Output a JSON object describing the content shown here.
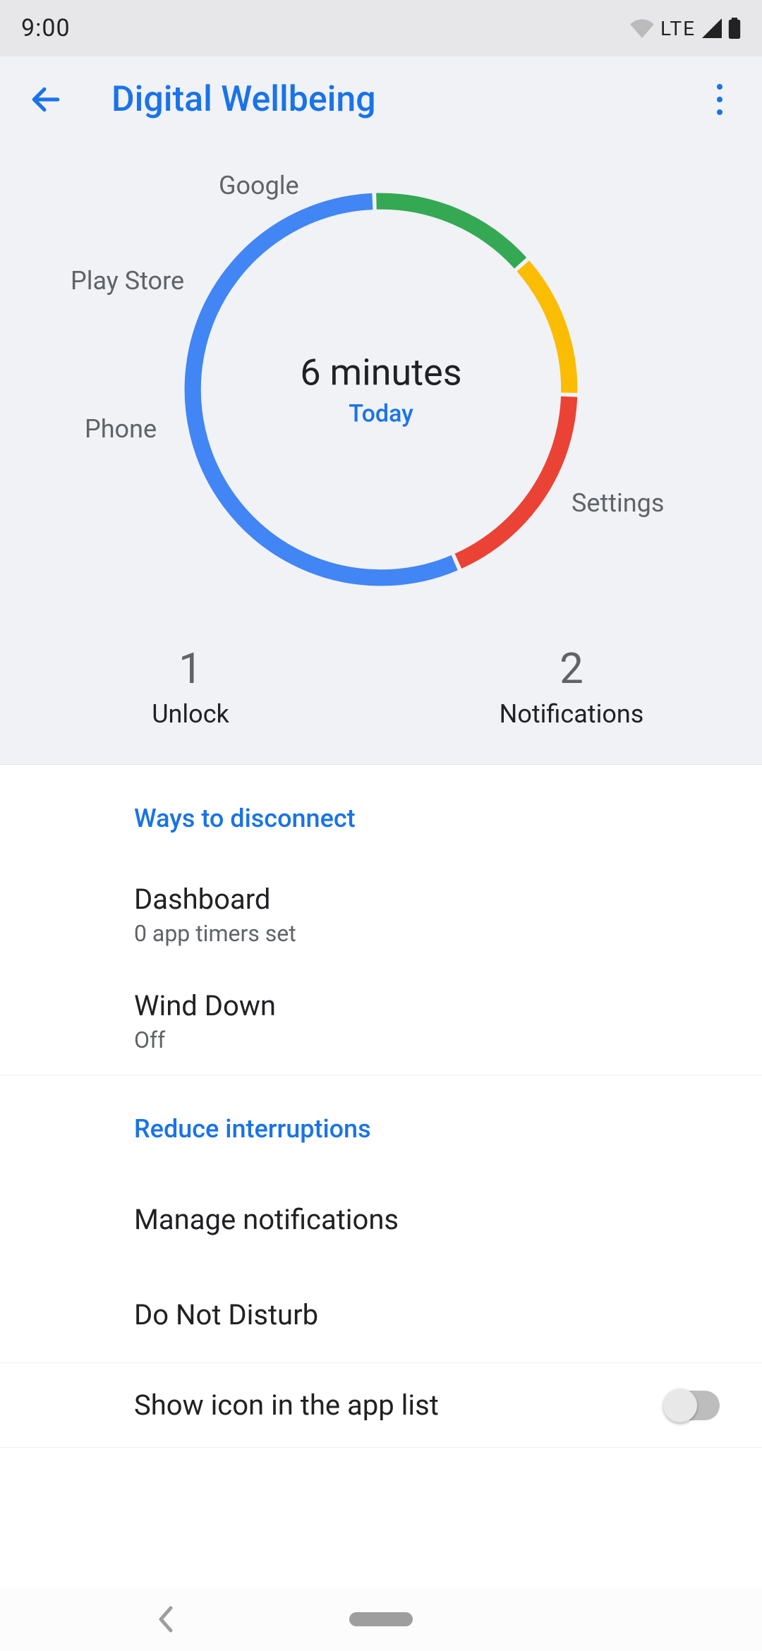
{
  "statusbar": {
    "time": "9:00",
    "network": "LTE"
  },
  "appbar": {
    "title": "Digital Wellbeing"
  },
  "chart_data": {
    "type": "pie",
    "title": "6 minutes",
    "subtitle": "Today",
    "series": [
      {
        "name": "Google",
        "value": 14,
        "color": "#34a853"
      },
      {
        "name": "Play Store",
        "value": 12,
        "color": "#fbbc04"
      },
      {
        "name": "Phone",
        "value": 18,
        "color": "#ea4335"
      },
      {
        "name": "Settings",
        "value": 56,
        "color": "#4285f4"
      }
    ]
  },
  "counters": {
    "unlock": {
      "value": "1",
      "label": "Unlock"
    },
    "notifications": {
      "value": "2",
      "label": "Notifications"
    }
  },
  "sections": {
    "disconnect": {
      "header": "Ways to disconnect",
      "dashboard": {
        "title": "Dashboard",
        "subtitle": "0 app timers set"
      },
      "winddown": {
        "title": "Wind Down",
        "subtitle": "Off"
      }
    },
    "reduce": {
      "header": "Reduce interruptions",
      "manage": {
        "title": "Manage notifications"
      },
      "dnd": {
        "title": "Do Not Disturb"
      }
    },
    "showicon": {
      "title": "Show icon in the app list",
      "enabled": false
    }
  }
}
